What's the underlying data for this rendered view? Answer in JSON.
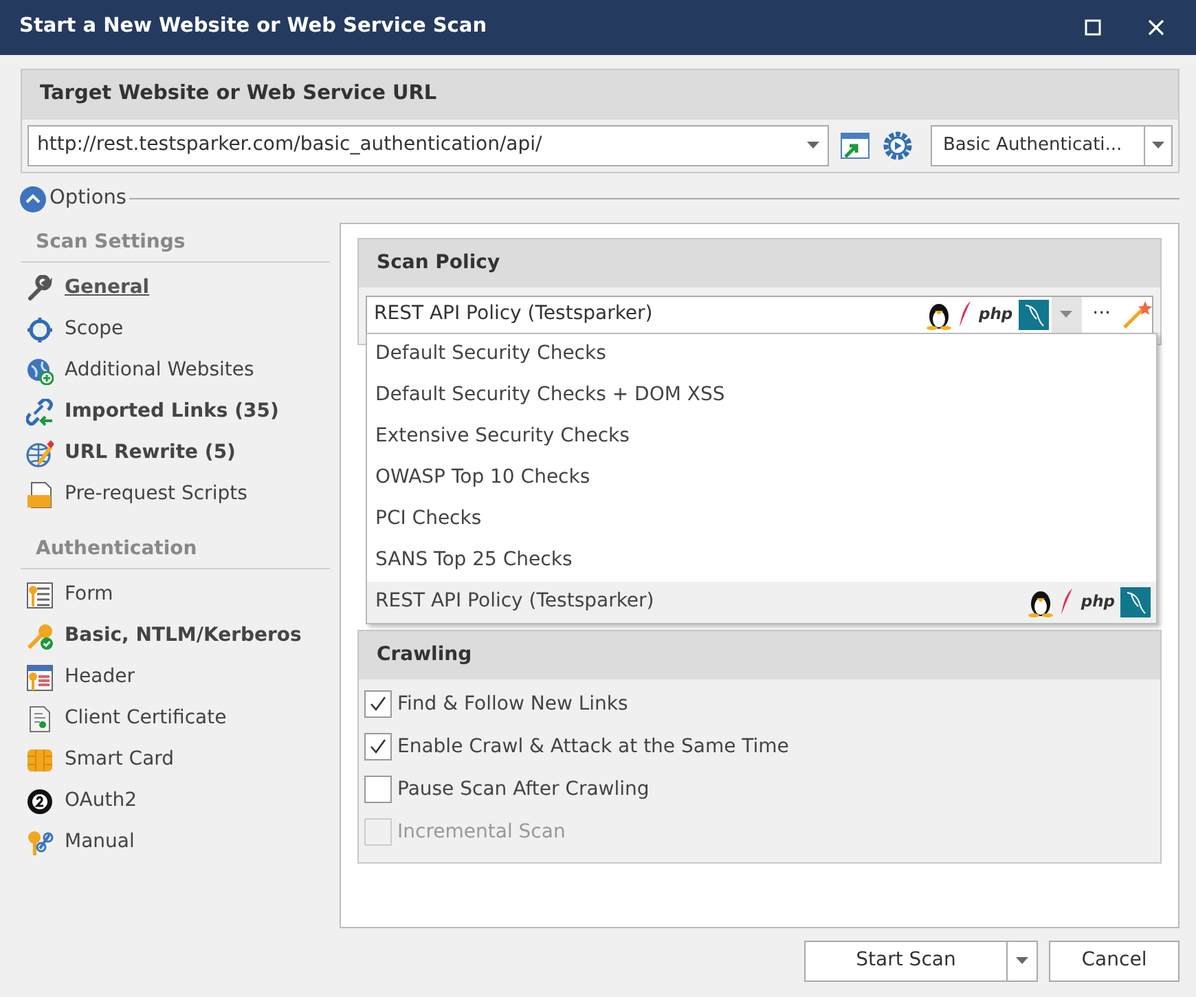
{
  "window": {
    "title": "Start a New Website or Web Service Scan"
  },
  "target": {
    "heading": "Target Website or Web Service URL",
    "url": "http://rest.testsparker.com/basic_authentication/api/",
    "auth_mode": "Basic Authenticati..."
  },
  "options": {
    "label": "Options",
    "expanded": true
  },
  "sidebar": [
    {
      "heading": "Scan Settings",
      "items": [
        {
          "label": "General",
          "selected": true,
          "configured": false
        },
        {
          "label": "Scope",
          "selected": false,
          "configured": false
        },
        {
          "label": "Additional Websites",
          "selected": false,
          "configured": false
        },
        {
          "label": "Imported Links (35)",
          "selected": false,
          "configured": true
        },
        {
          "label": "URL Rewrite (5)",
          "selected": false,
          "configured": true
        },
        {
          "label": "Pre-request Scripts",
          "selected": false,
          "configured": false
        }
      ]
    },
    {
      "heading": "Authentication",
      "items": [
        {
          "label": "Form",
          "selected": false,
          "configured": false
        },
        {
          "label": "Basic, NTLM/Kerberos",
          "selected": false,
          "configured": true
        },
        {
          "label": "Header",
          "selected": false,
          "configured": false
        },
        {
          "label": "Client Certificate",
          "selected": false,
          "configured": false
        },
        {
          "label": "Smart Card",
          "selected": false,
          "configured": false
        },
        {
          "label": "OAuth2",
          "selected": false,
          "configured": false
        },
        {
          "label": "Manual",
          "selected": false,
          "configured": false
        }
      ]
    }
  ],
  "scan_policy": {
    "heading": "Scan Policy",
    "value": "REST API Policy (Testsparker)",
    "tech_icons": true,
    "php_label": "php",
    "more_label": "···",
    "options": [
      {
        "label": "Default Security Checks",
        "selected": false,
        "tech_icons": false
      },
      {
        "label": "Default Security Checks + DOM XSS",
        "selected": false,
        "tech_icons": false
      },
      {
        "label": "Extensive Security Checks",
        "selected": false,
        "tech_icons": false
      },
      {
        "label": "OWASP Top 10 Checks",
        "selected": false,
        "tech_icons": false
      },
      {
        "label": "PCI Checks",
        "selected": false,
        "tech_icons": false
      },
      {
        "label": "SANS Top 25 Checks",
        "selected": false,
        "tech_icons": false
      },
      {
        "label": "REST API Policy (Testsparker)",
        "selected": true,
        "tech_icons": true,
        "php_label": "php"
      }
    ]
  },
  "crawling": {
    "heading": "Crawling",
    "options": [
      {
        "label": "Find & Follow New Links",
        "checked": true,
        "disabled": false
      },
      {
        "label": "Enable Crawl & Attack at the Same Time",
        "checked": true,
        "disabled": false
      },
      {
        "label": "Pause Scan After Crawling",
        "checked": false,
        "disabled": false
      },
      {
        "label": "Incremental Scan",
        "checked": false,
        "disabled": true
      }
    ]
  },
  "buttons": {
    "start": "Start Scan",
    "cancel": "Cancel"
  }
}
